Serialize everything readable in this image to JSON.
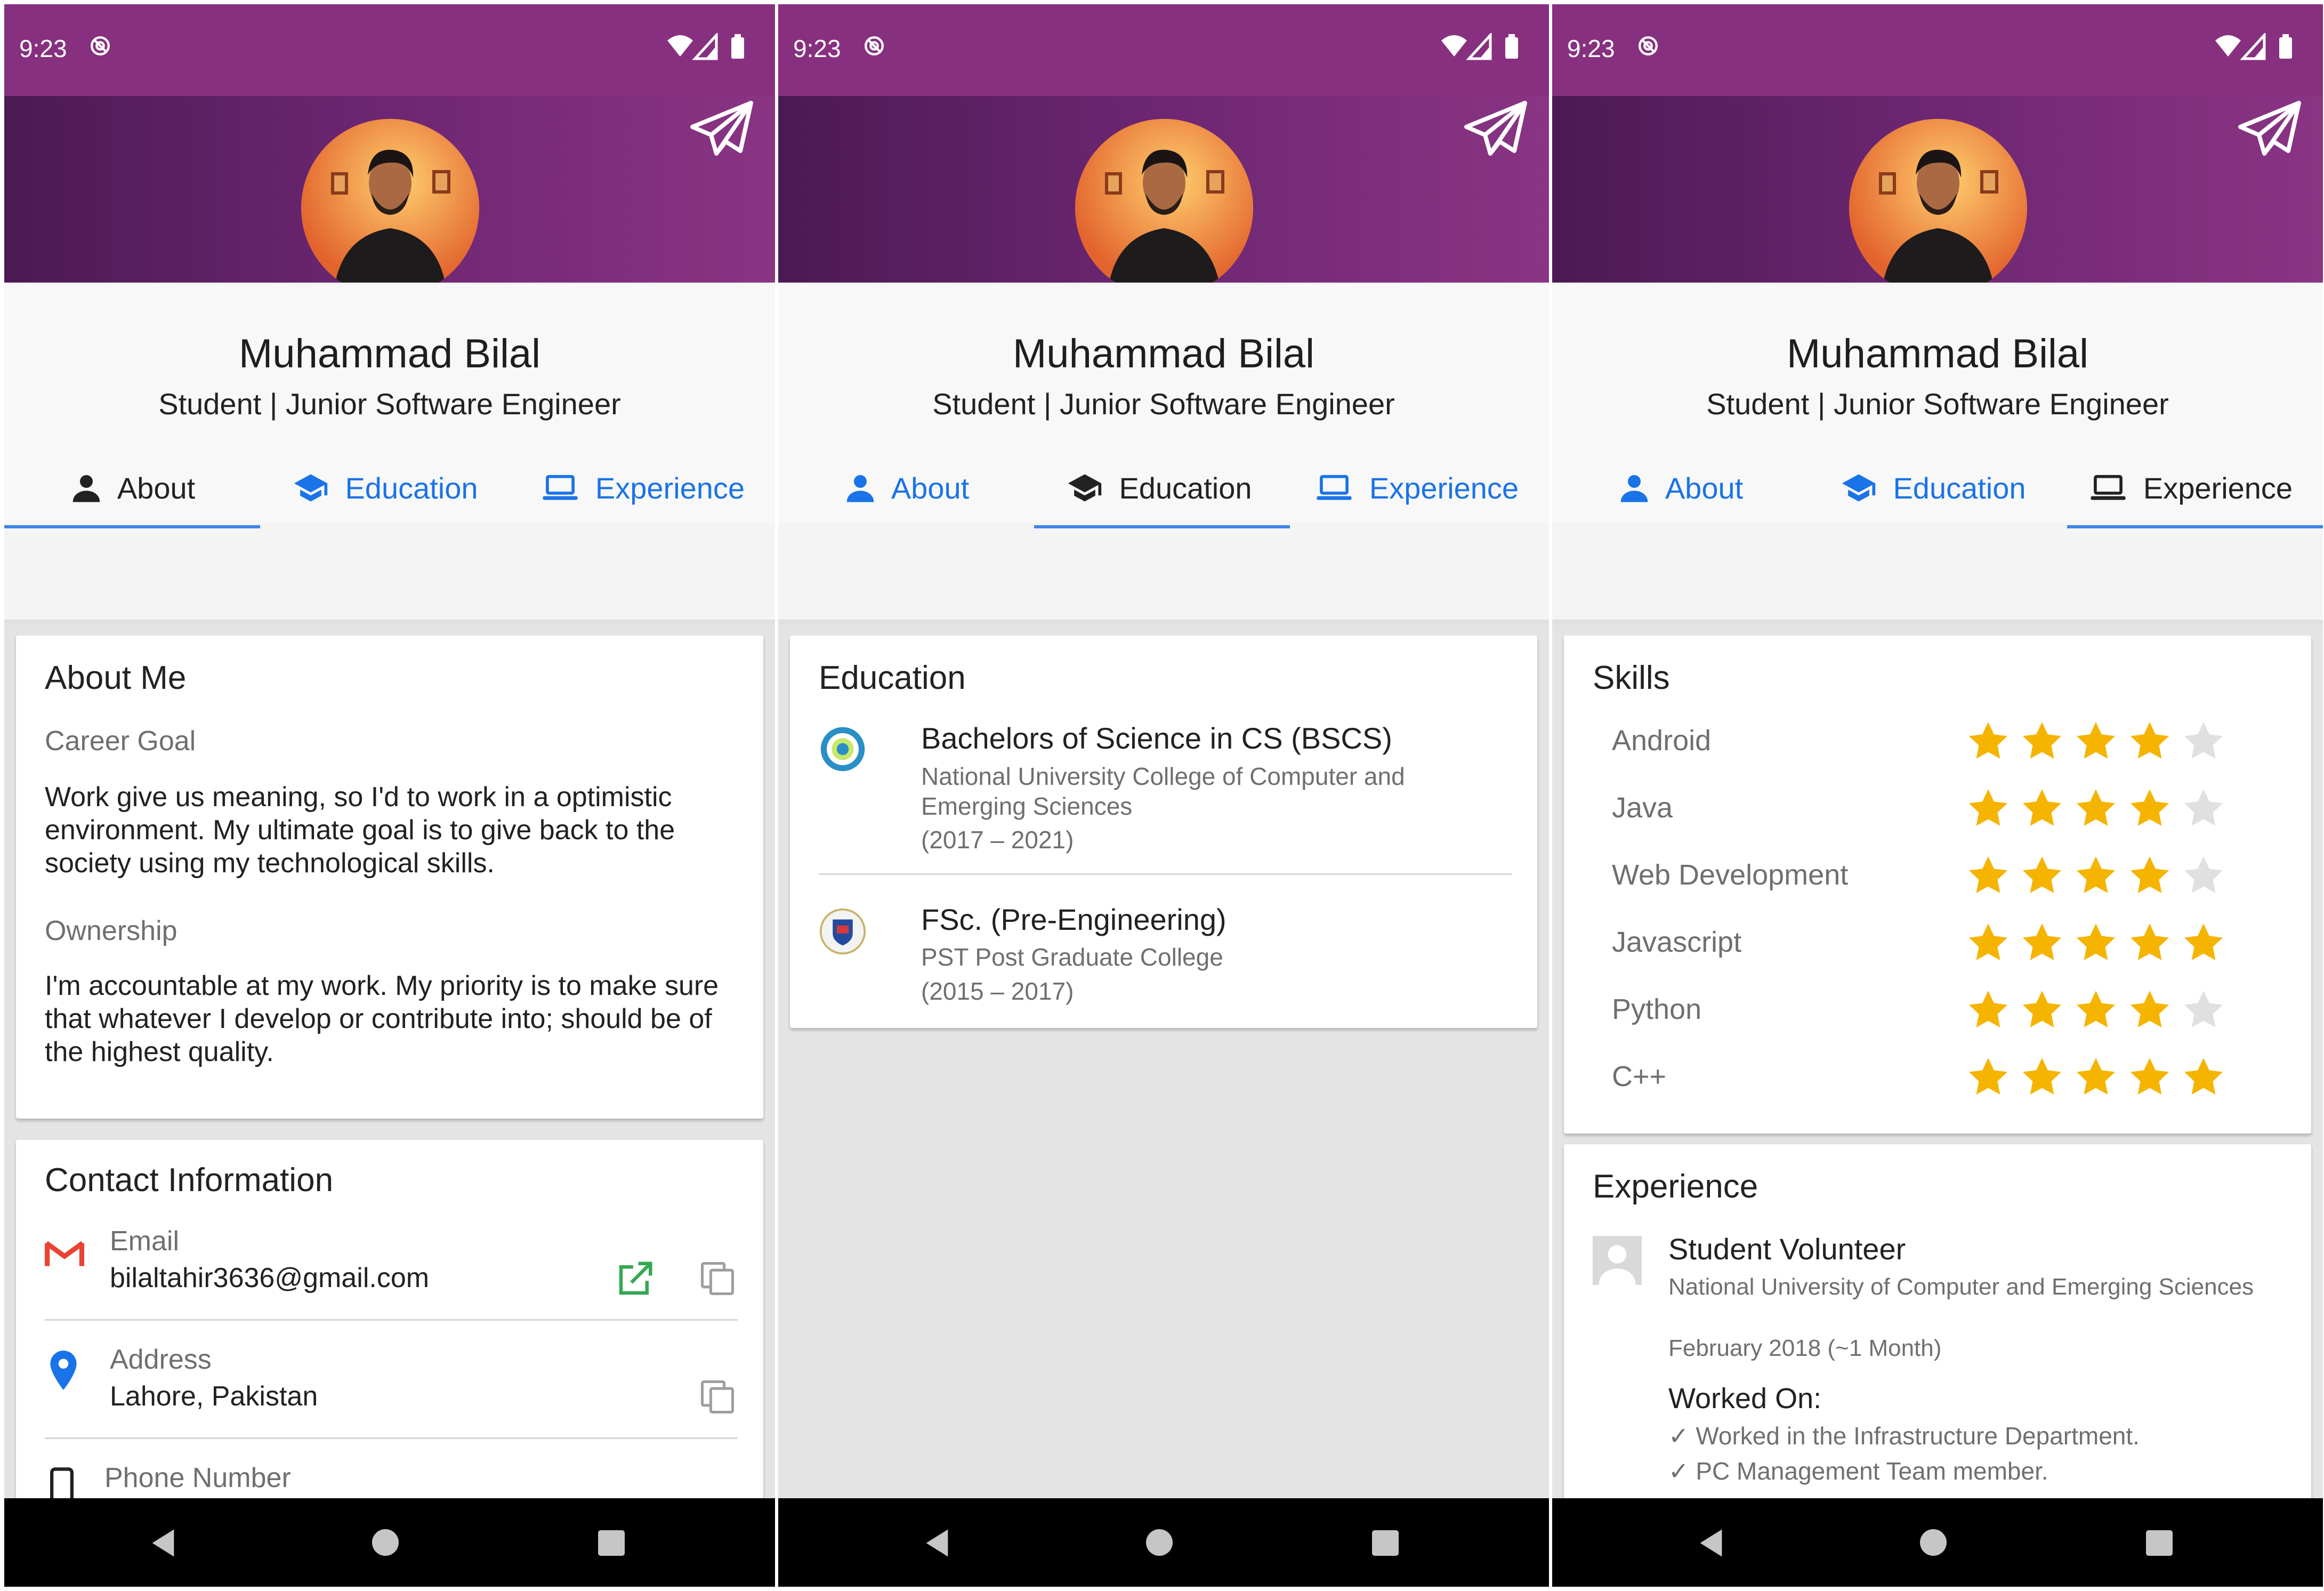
{
  "status_bar": {
    "time": "9:23"
  },
  "profile": {
    "name": "Muhammad Bilal",
    "title": "Student | Junior Software Engineer"
  },
  "tabs": [
    {
      "label": "About",
      "icon": "person-icon"
    },
    {
      "label": "Education",
      "icon": "graduation-cap-icon"
    },
    {
      "label": "Experience",
      "icon": "laptop-icon"
    }
  ],
  "about": {
    "card_title": "About Me",
    "career_goal_label": "Career Goal",
    "career_goal_text": "Work give us meaning, so I'd to work in a optimistic environment. My ultimate goal is to give back to the society using my technological skills.",
    "ownership_label": "Ownership",
    "ownership_text": "I'm accountable at my work. My priority is to make sure that whatever I develop or contribute into; should be of the highest quality."
  },
  "contact": {
    "card_title": "Contact Information",
    "email_label": "Email",
    "email_value": "bilaltahir3636@gmail.com",
    "address_label": "Address",
    "address_value": "Lahore, Pakistan",
    "phone_label": "Phone Number"
  },
  "education": {
    "card_title": "Education",
    "items": [
      {
        "degree": "Bachelors of Science in CS (BSCS)",
        "institute": "National University College of Computer and Emerging Sciences",
        "years": "(2017 – 2021)"
      },
      {
        "degree": "FSc. (Pre-Engineering)",
        "institute": "PST Post Graduate College",
        "years": "(2015 – 2017)"
      }
    ]
  },
  "skills": {
    "card_title": "Skills",
    "items": [
      {
        "name": "Android",
        "rating": 4
      },
      {
        "name": "Java",
        "rating": 4
      },
      {
        "name": "Web Development",
        "rating": 4
      },
      {
        "name": "Javascript",
        "rating": 5
      },
      {
        "name": "Python",
        "rating": 4
      },
      {
        "name": "C++",
        "rating": 5
      }
    ],
    "max_rating": 5
  },
  "experience": {
    "card_title": "Experience",
    "role": "Student Volunteer",
    "organization": "National University of Computer and Emerging Sciences",
    "duration": "February 2018 (~1 Month)",
    "worked_on_label": "Worked On:",
    "points": [
      "✓ Worked in the Infrastructure Department.",
      "✓ PC Management Team member."
    ]
  },
  "colors": {
    "accent": "#1a73e8",
    "header": "#87307f",
    "star_on": "#f5b400",
    "star_off": "#e0e0e0"
  }
}
